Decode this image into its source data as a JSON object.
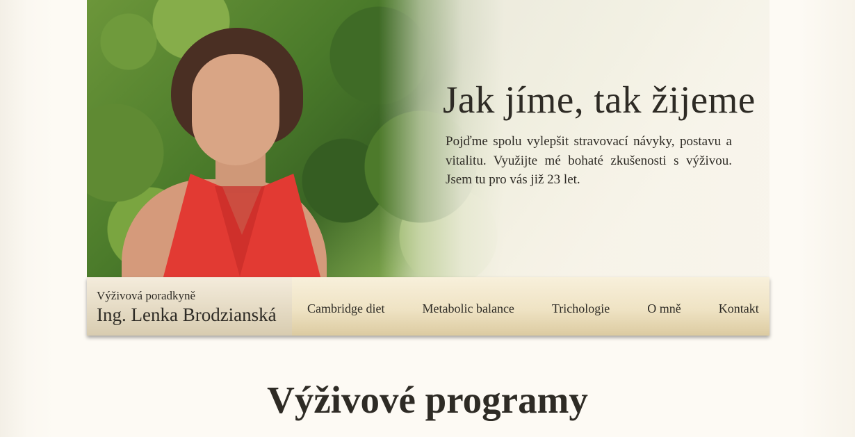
{
  "hero": {
    "title": "Jak jíme, tak žijeme",
    "text": "Pojďme spolu vylepšit stravovací návyky, postavu a vitalitu. Využijte mé bohaté zkušenosti s výživou. Jsem tu pro vás již  23 let."
  },
  "brand": {
    "subtitle": "Výživová poradkyně",
    "name": "Ing. Lenka Brodzianská"
  },
  "nav": {
    "items": [
      {
        "label": "Cambridge diet"
      },
      {
        "label": "Metabolic balance"
      },
      {
        "label": "Trichologie"
      },
      {
        "label": "O mně"
      },
      {
        "label": "Kontakt"
      }
    ]
  },
  "section": {
    "title": "Výživové programy"
  },
  "colors": {
    "accent_dress": "#e23a33",
    "navbar_gold": "#dccba1",
    "background": "#fdfaf3",
    "text": "#2e2b25"
  }
}
